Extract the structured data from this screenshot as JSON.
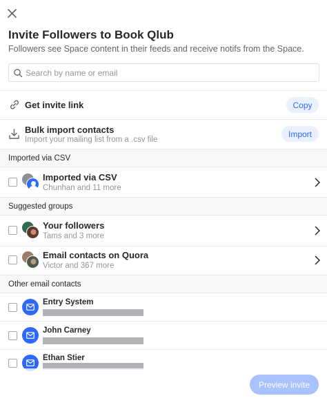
{
  "dialog": {
    "title": "Invite Followers to Book Qlub",
    "subtitle": "Followers see Space content in their feeds and receive notifs from the Space."
  },
  "search": {
    "placeholder": "Search by name or email",
    "icon": "search-icon"
  },
  "invite_link": {
    "label": "Get invite link",
    "button": "Copy",
    "icon": "link-icon"
  },
  "bulk_import": {
    "label": "Bulk import contacts",
    "sub": "Import your mailing list from a .csv file",
    "button": "Import",
    "icon": "download-icon"
  },
  "sections": {
    "imported": {
      "header": "Imported via CSV",
      "items": [
        {
          "title": "Imported via CSV",
          "sub": "Chunhan and 11 more"
        }
      ]
    },
    "suggested": {
      "header": "Suggested groups",
      "items": [
        {
          "title": "Your followers",
          "sub": "Tams and 3 more"
        },
        {
          "title": "Email contacts on Quora",
          "sub": "Victor and 367 more"
        }
      ]
    },
    "other": {
      "header": "Other email contacts",
      "contacts": [
        {
          "name": "Entry System"
        },
        {
          "name": "John Carney"
        },
        {
          "name": "Ethan Stier"
        }
      ]
    }
  },
  "footer": {
    "preview_button": "Preview invite"
  },
  "colors": {
    "accent": "#2e69ff",
    "accent_light": "#ebf0ff",
    "button_disabled": "#a8c1ff",
    "section_bg": "#f7f7f8",
    "redaction": "#b1b3b6"
  }
}
